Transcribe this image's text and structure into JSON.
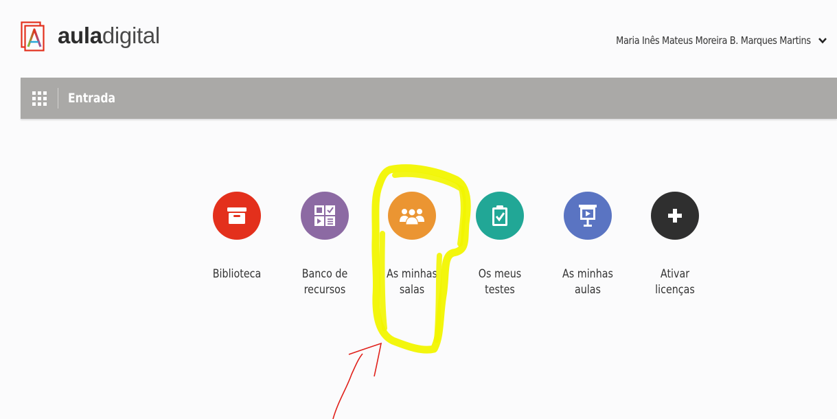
{
  "header": {
    "logo_bold": "aula",
    "logo_light": "digital",
    "user_name": "Maria Inês Mateus Moreira B. Marques Martins"
  },
  "topbar": {
    "title": "Entrada"
  },
  "tiles": [
    {
      "label": "Biblioteca",
      "color": "#e3301c",
      "icon": "archive-box-icon"
    },
    {
      "label": "Banco de\nrecursos",
      "color": "#8c6aa3",
      "icon": "resource-grid-icon"
    },
    {
      "label": "As minhas\nsalas",
      "color": "#eb9532",
      "icon": "group-users-icon"
    },
    {
      "label": "Os meus\ntestes",
      "color": "#21a796",
      "icon": "clipboard-check-icon"
    },
    {
      "label": "As minhas\naulas",
      "color": "#5a74c2",
      "icon": "presentation-board-icon"
    },
    {
      "label": "Ativar\nlicenças",
      "color": "#2f2f2f",
      "icon": "plus-icon"
    }
  ],
  "colors": {
    "topbar": "#aaa9a7",
    "highlight": "#f2f500",
    "arrow": "#e0201a"
  }
}
